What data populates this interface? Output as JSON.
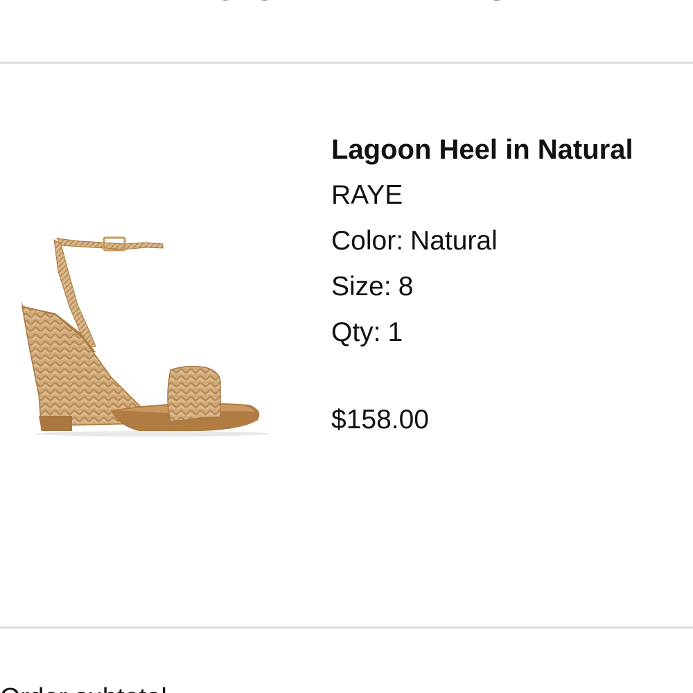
{
  "section": {
    "heading": "YOUR ITEMS"
  },
  "item": {
    "name": "Lagoon Heel in Natural",
    "brand": "RAYE",
    "color_label": "Color:",
    "color_value": "Natural",
    "size_label": "Size:",
    "size_value": "8",
    "qty_label": "Qty:",
    "qty_value": "1",
    "price": "$158.00",
    "image_icon": "wedge-sandal-image"
  },
  "footer": {
    "partial_text": "Order subtotal"
  },
  "colors": {
    "divider": "#dcdcdc",
    "text": "#111111",
    "sandal_light": "#d4ae7e",
    "sandal_dark": "#a9773f"
  }
}
